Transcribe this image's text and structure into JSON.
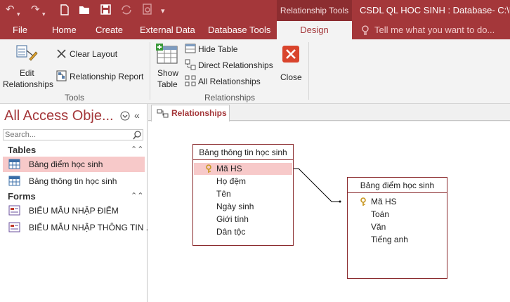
{
  "window": {
    "title": "CSDL QL HOC SINH : Database- C:\\Users",
    "context_group": "Relationship Tools"
  },
  "quick_access": [
    "undo-icon",
    "redo-icon",
    "new-file-icon",
    "open-folder-icon",
    "save-icon",
    "sync-icon",
    "print-preview-icon",
    "customize-icon"
  ],
  "tabs": [
    {
      "label": "File"
    },
    {
      "label": "Home"
    },
    {
      "label": "Create"
    },
    {
      "label": "External Data"
    },
    {
      "label": "Database Tools"
    },
    {
      "label": "Design"
    }
  ],
  "tell_me": "Tell me what you want to do...",
  "ribbon": {
    "tools": {
      "group_label": "Tools",
      "edit_relationships_line1": "Edit",
      "edit_relationships_line2": "Relationships",
      "clear_layout": "Clear Layout",
      "relationship_report": "Relationship Report"
    },
    "relationships": {
      "group_label": "Relationships",
      "show_table_line1": "Show",
      "show_table_line2": "Table",
      "hide_table": "Hide Table",
      "direct_relationships": "Direct Relationships",
      "all_relationships": "All Relationships",
      "close": "Close"
    }
  },
  "nav": {
    "title": "All Access Obje...",
    "search_placeholder": "Search...",
    "groups": [
      {
        "label": "Tables",
        "items": [
          {
            "label": "Bảng điểm học sinh",
            "selected": true
          },
          {
            "label": "Bảng thông tin học sinh",
            "selected": false
          }
        ]
      },
      {
        "label": "Forms",
        "items": [
          {
            "label": "BIỂU MẪU NHẬP ĐIỂM",
            "selected": false
          },
          {
            "label": "BIỂU MẪU NHẬP THÔNG TIN ...",
            "selected": false
          }
        ]
      }
    ]
  },
  "document_tab": {
    "label": "Relationships"
  },
  "tables": [
    {
      "name": "Bảng thông tin học sinh",
      "fields": [
        {
          "name": "Mã HS",
          "key": true,
          "selected": true
        },
        {
          "name": "Họ đệm",
          "key": false,
          "selected": false
        },
        {
          "name": "Tên",
          "key": false,
          "selected": false
        },
        {
          "name": "Ngày sinh",
          "key": false,
          "selected": false
        },
        {
          "name": "Giới tính",
          "key": false,
          "selected": false
        },
        {
          "name": "Dân tộc",
          "key": false,
          "selected": false
        }
      ]
    },
    {
      "name": "Bảng điểm học sinh",
      "fields": [
        {
          "name": "Mã HS",
          "key": true,
          "selected": false
        },
        {
          "name": "Toán",
          "key": false,
          "selected": false
        },
        {
          "name": "Văn",
          "key": false,
          "selected": false
        },
        {
          "name": "Tiếng anh",
          "key": false,
          "selected": false
        }
      ]
    }
  ],
  "colors": {
    "brand": "#a4373a",
    "selection": "#f7c9c9",
    "close_button": "#d9442c"
  }
}
